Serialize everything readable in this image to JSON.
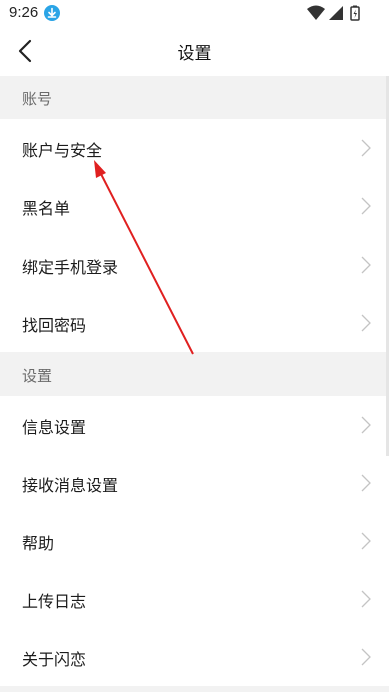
{
  "status_bar": {
    "time": "9:26",
    "icons": [
      "download-icon",
      "wifi-icon",
      "signal-icon",
      "battery-icon"
    ]
  },
  "header": {
    "title": "设置",
    "back_icon": "chevron-left-icon"
  },
  "sections": [
    {
      "title": "账号",
      "items": [
        {
          "label": "账户与安全",
          "icon": "chevron-right-icon"
        },
        {
          "label": "黑名单",
          "icon": "chevron-right-icon"
        },
        {
          "label": "绑定手机登录",
          "icon": "chevron-right-icon"
        },
        {
          "label": "找回密码",
          "icon": "chevron-right-icon"
        }
      ]
    },
    {
      "title": "设置",
      "items": [
        {
          "label": "信息设置",
          "icon": "chevron-right-icon"
        },
        {
          "label": "接收消息设置",
          "icon": "chevron-right-icon"
        },
        {
          "label": "帮助",
          "icon": "chevron-right-icon"
        },
        {
          "label": "上传日志",
          "icon": "chevron-right-icon"
        },
        {
          "label": "关于闪恋",
          "icon": "chevron-right-icon"
        }
      ]
    }
  ],
  "colors": {
    "section_background": "#f2f2f2",
    "annotation_arrow": "#e02020",
    "download_badge": "#2aa4e6"
  }
}
